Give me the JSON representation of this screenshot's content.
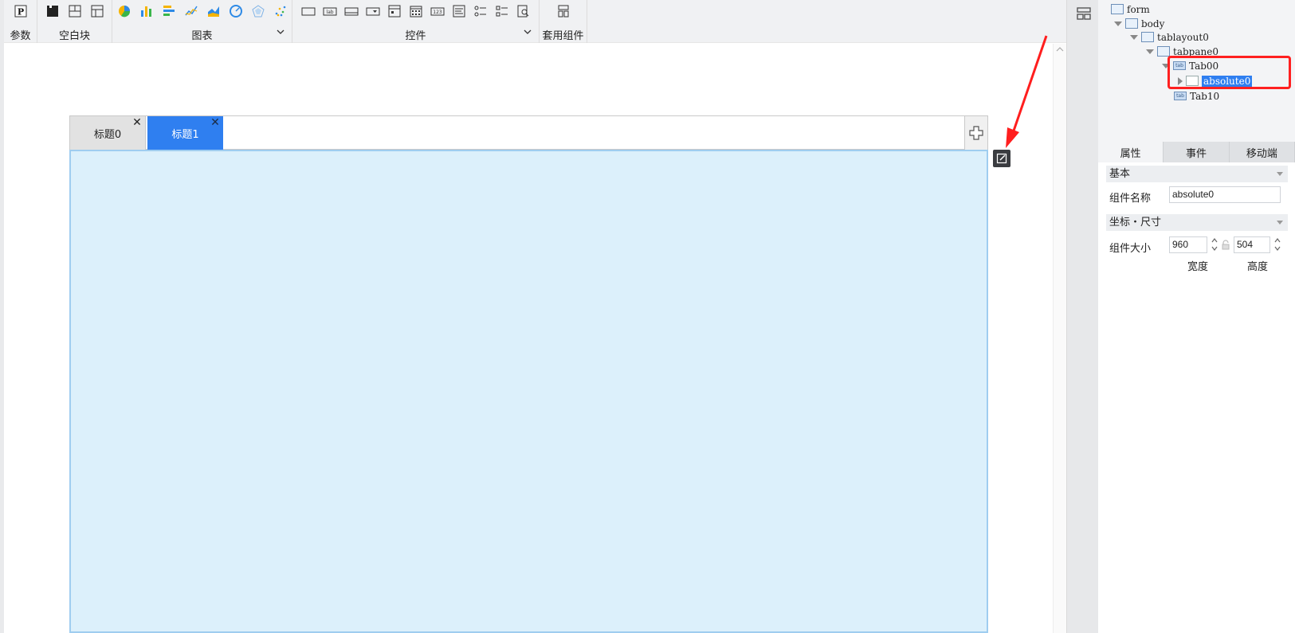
{
  "toolbar": {
    "groups": [
      {
        "label": "参数"
      },
      {
        "label": "空白块"
      },
      {
        "label": "图表"
      },
      {
        "label": "控件"
      },
      {
        "label": "套用组件"
      }
    ]
  },
  "tabpane": {
    "tabs": [
      {
        "label": "标题0",
        "active": false
      },
      {
        "label": "标题1",
        "active": true
      }
    ]
  },
  "tree": {
    "nodes": [
      {
        "label": "form"
      },
      {
        "label": "body"
      },
      {
        "label": "tablayout0"
      },
      {
        "label": "tabpane0"
      },
      {
        "label": "Tab00"
      },
      {
        "label": "absolute0"
      },
      {
        "label": "Tab10"
      }
    ],
    "tab_icon_text": "tab"
  },
  "panel_tabs": [
    {
      "label": "属性"
    },
    {
      "label": "事件"
    },
    {
      "label": "移动端"
    }
  ],
  "props": {
    "basic_section": "基本",
    "name_label": "组件名称",
    "name_value": "absolute0",
    "geometry_section": "坐标・尺寸",
    "size_label": "组件大小",
    "width_value": "960",
    "height_value": "504",
    "width_label": "宽度",
    "height_label": "高度"
  },
  "colors": {
    "accent": "#2f7ff0",
    "highlight": "#ff2020",
    "content_bg": "#dcf0fb"
  }
}
